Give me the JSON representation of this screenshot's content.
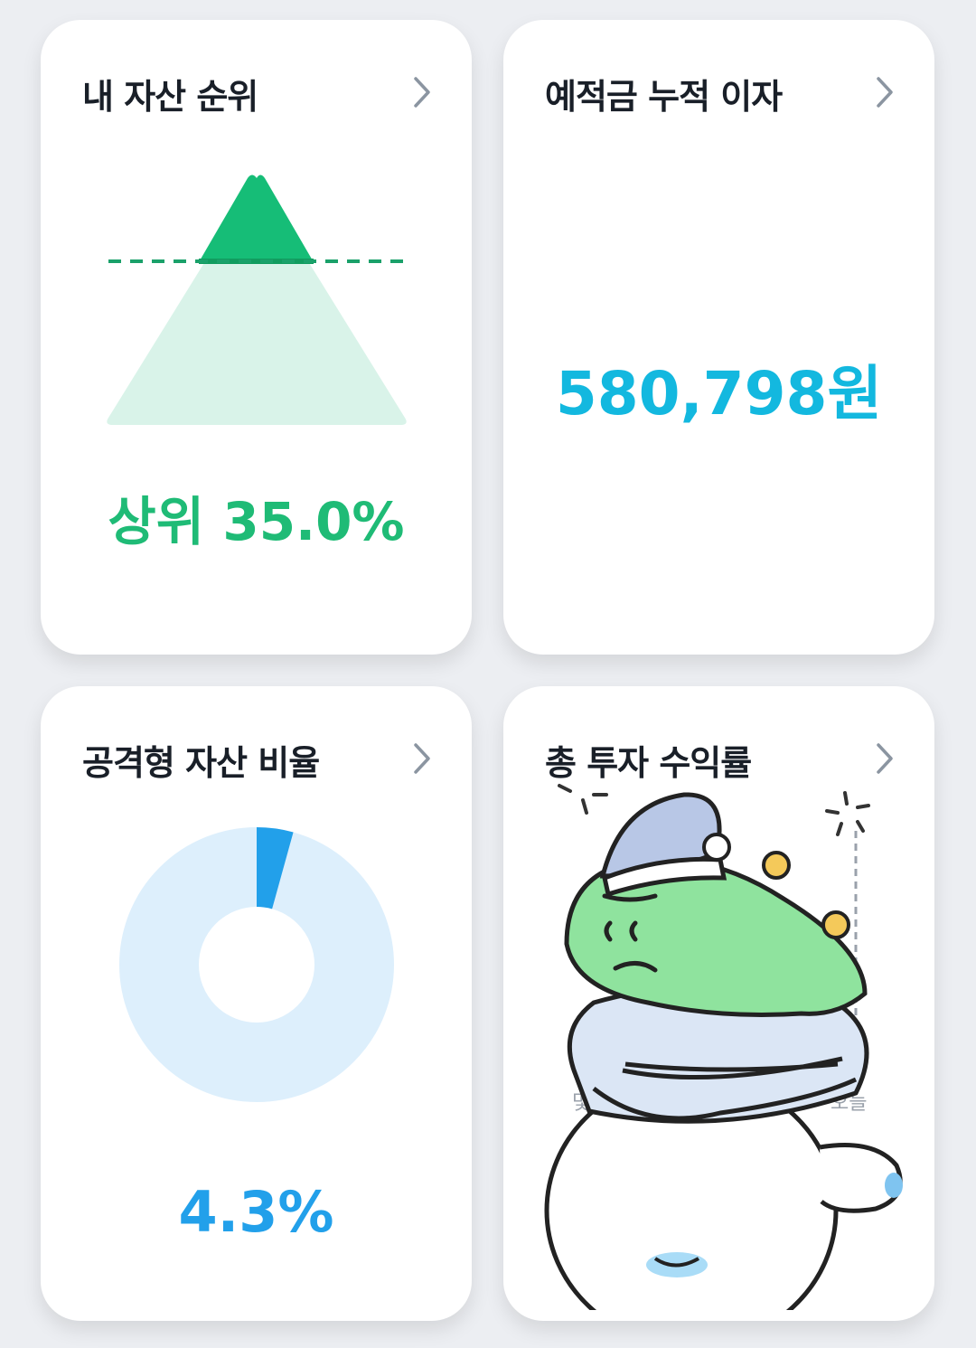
{
  "cards": {
    "asset_rank": {
      "title": "내 자산 순위",
      "value": "상위 35.0%",
      "top_percent": 35.0,
      "colors": {
        "accent": "#16bd77",
        "light": "#d9f3e9"
      }
    },
    "interest": {
      "title": "예적금 누적 이자",
      "value": "580,798원",
      "color": "#13b8df"
    },
    "aggressive_ratio": {
      "title": "공격형 자산 비율",
      "value": "4.3%",
      "ratio_percent": 4.3,
      "colors": {
        "accent": "#22a0ea",
        "light": "#ddeffc"
      }
    },
    "total_return": {
      "title": "총 투자 수익률",
      "axis_labels": {
        "start": "몇",
        "end": "오늘"
      },
      "sticker": "sleeping-dinosaur-sticker"
    }
  },
  "icons": {
    "chevron": "chevron-right-icon"
  }
}
